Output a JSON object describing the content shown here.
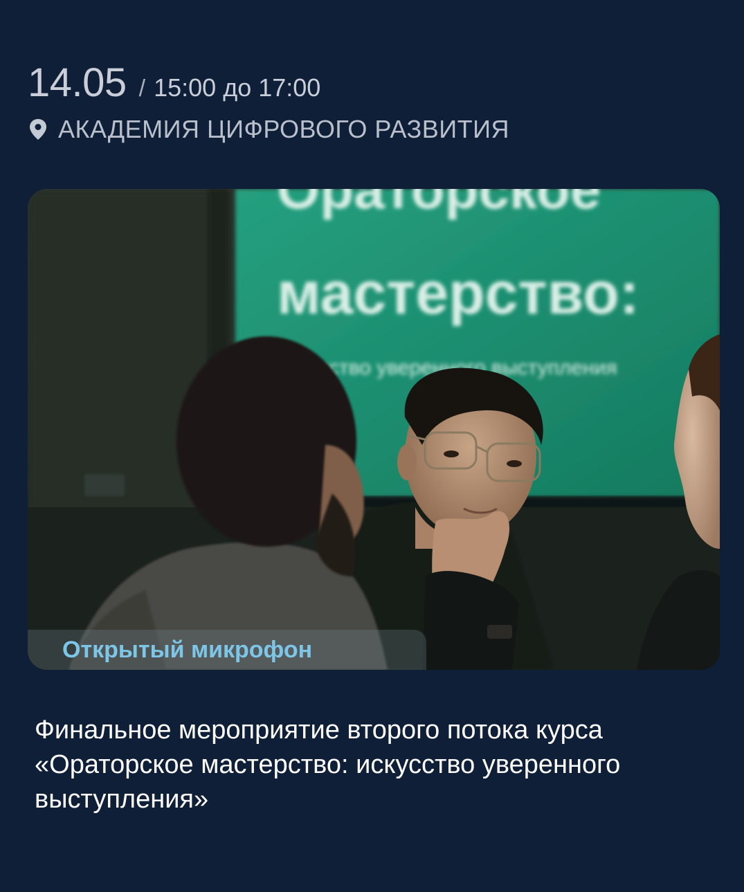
{
  "event": {
    "date": "14.05",
    "separator": "/",
    "time_range": "15:00 до 17:00",
    "location_icon": "location-pin-icon",
    "location": "АКАДЕМИЯ ЦИФРОВОГО РАЗВИТИЯ",
    "photo": {
      "screen_text_line1": "Ораторское",
      "screen_text_line2": "мастерство:",
      "screen_text_line3": "искусство уверенного выступления"
    },
    "tag": "Открытый микрофон",
    "title": "Финальное мероприятие второго потока курса «Ораторское мастерство: искусство уверенного выступления»"
  },
  "colors": {
    "background": "#0f1f38",
    "tag_text": "#7ec6e8",
    "title_text": "#ffffff",
    "screen_green": "#1f8f72"
  }
}
